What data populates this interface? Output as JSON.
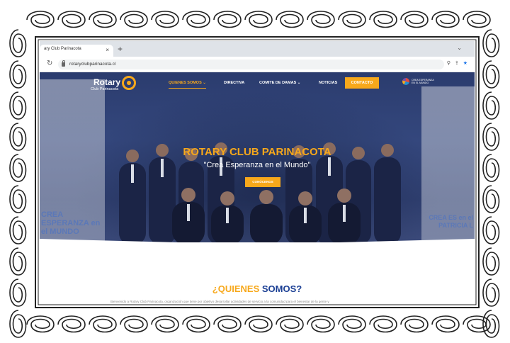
{
  "browser": {
    "tab_title": "ary Club Parinacota",
    "tab_close": "×",
    "new_tab": "+",
    "url": "rotaryclubparinacota.cl"
  },
  "site": {
    "logo_word": "Rotary",
    "logo_sub": "Club Parinacota",
    "menu": [
      {
        "label": "QUIENES SOMOS ⌄"
      },
      {
        "label": "DIRECTIVA"
      },
      {
        "label": "COMITE DE DAMAS ⌄"
      },
      {
        "label": "NOTICIAS"
      }
    ],
    "contact_label": "CONTACTO",
    "corner_logo_text": "CREA ESPERANZA EN EL MUNDO",
    "hero_title": "ROTARY CLUB PARINACOTA",
    "hero_tagline": "\"Crea Esperanza en el Mundo\"",
    "hero_button": "CONÓCENOS",
    "banner_left_text": "CREA ESPERANZA en el MUNDO",
    "banner_right_text": "CREA ES en el",
    "banner_right_name": "PATRICIA L",
    "about_title_orange": "¿QUIENES",
    "about_title_blue": "SOMOS?",
    "about_text": "Bienvenido a Rotary Club Parinacota, organización que tiene por objetivo desarrollar actividades de servicio a la comunidad para el bienestar de la gente y"
  },
  "colors": {
    "accent": "#f7a81b",
    "brand_blue": "#1b3f94",
    "hero_overlay": "#2f3f70"
  },
  "icons": [
    "reload-icon",
    "lock-icon",
    "zoom-icon",
    "share-icon",
    "star-icon",
    "rotary-wheel-icon",
    "chevron-down-icon"
  ]
}
